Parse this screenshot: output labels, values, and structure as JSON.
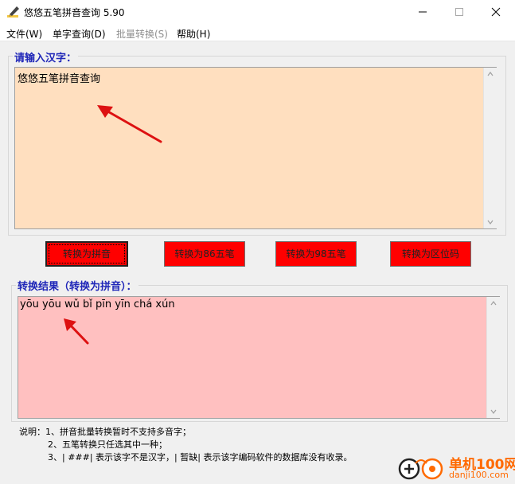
{
  "window": {
    "title": "悠悠五笔拼音查询 5.90"
  },
  "menu": [
    {
      "label": "文件(W)",
      "enabled": true
    },
    {
      "label": "单字查询(D)",
      "enabled": true
    },
    {
      "label": "批量转换(S)",
      "enabled": false
    },
    {
      "label": "帮助(H)",
      "enabled": true
    }
  ],
  "input_section": {
    "label": "请输入汉字：",
    "value": "悠悠五笔拼音查询"
  },
  "buttons": [
    {
      "label": "转换为拼音"
    },
    {
      "label": "转换为86五笔"
    },
    {
      "label": "转换为98五笔"
    },
    {
      "label": "转换为区位码"
    }
  ],
  "result_section": {
    "label": "转换结果（转换为拼音）：",
    "value": "yōu yōu wǔ bǐ pīn yīn chá xún"
  },
  "notes": [
    "说明：1、拼音批量转换暂时不支持多音字；",
    "2、五笔转换只任选其中一种；",
    "3、| ###| 表示该字不是汉字，| 暂缺| 表示该字编码软件的数据库没有收录。"
  ],
  "watermark": {
    "title": "单机100网",
    "url": "danji100.com"
  },
  "colors": {
    "input_bg": "#ffdfbf",
    "result_bg": "#ffc0c0",
    "button_bg": "#ff0000",
    "label_color": "#1f26b8",
    "annotation_arrow": "#dd1111"
  }
}
